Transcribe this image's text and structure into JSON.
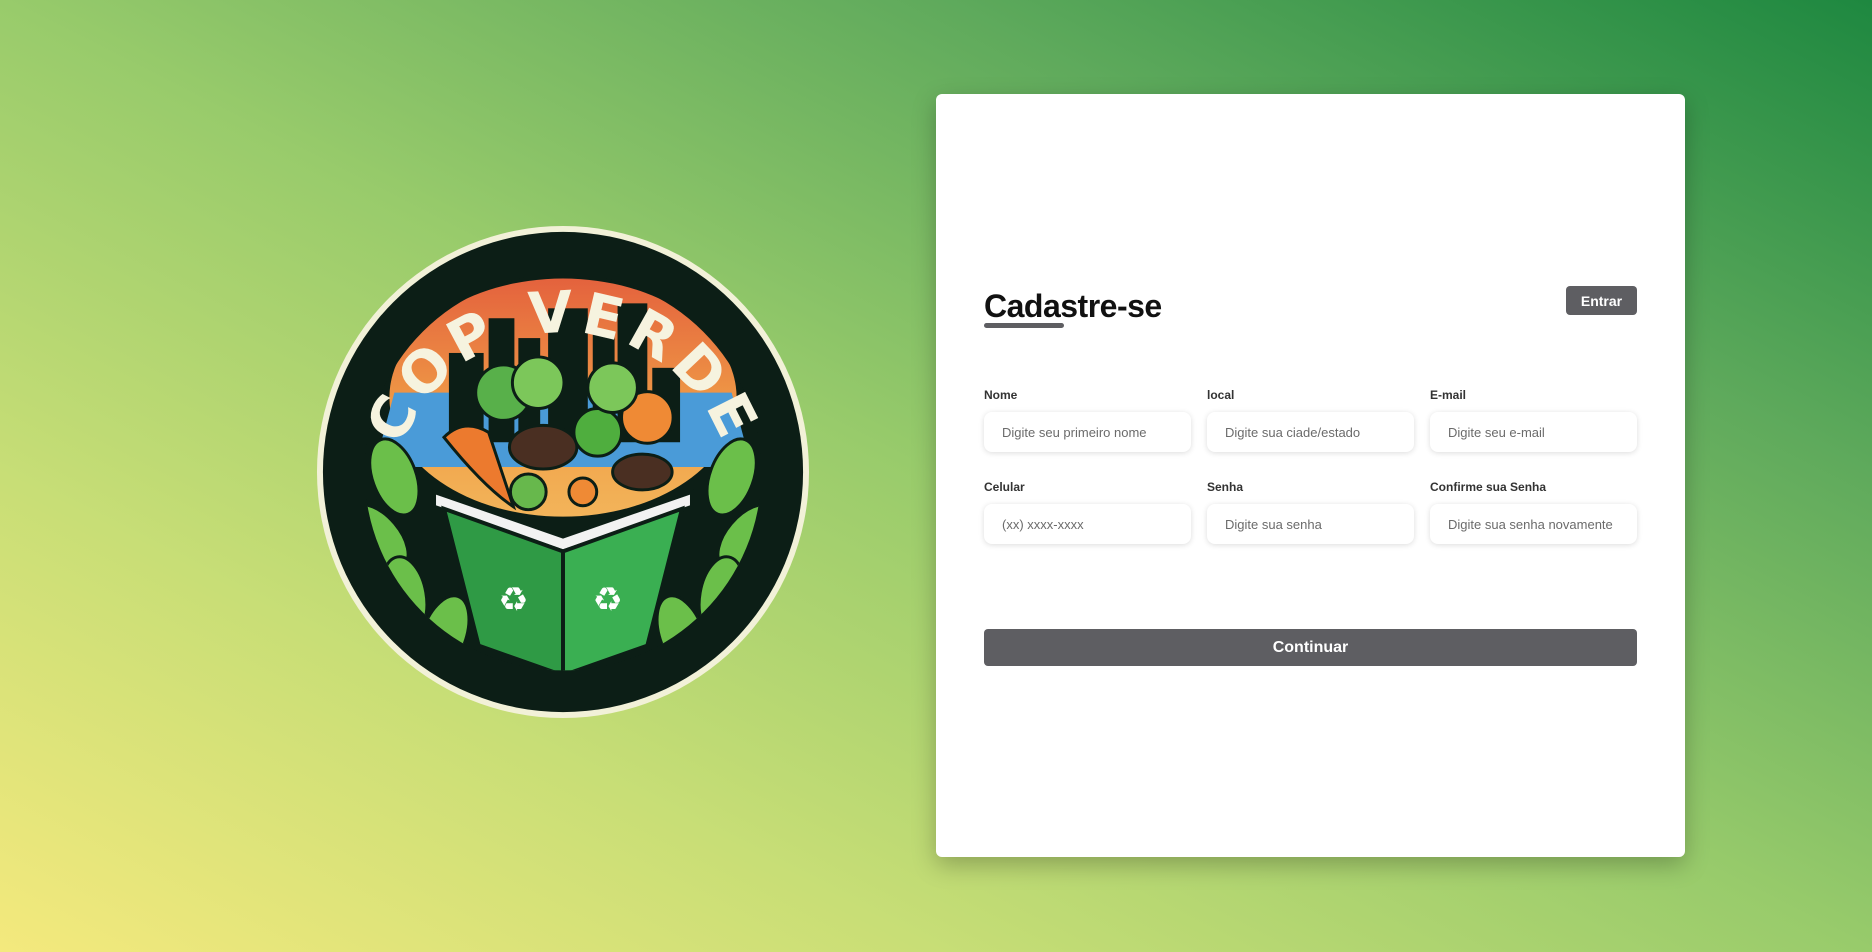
{
  "logo": {
    "brand_text": "COP VERDE",
    "icon": "recycle-bin-with-vegetables-logo"
  },
  "form": {
    "title": "Cadastre-se",
    "enter_button": "Entrar",
    "fields": [
      {
        "label": "Nome",
        "placeholder": "Digite seu primeiro nome",
        "value": ""
      },
      {
        "label": "local",
        "placeholder": "Digite sua ciade/estado",
        "value": ""
      },
      {
        "label": "E-mail",
        "placeholder": "Digite seu e-mail",
        "value": ""
      },
      {
        "label": "Celular",
        "placeholder": "(xx) xxxx-xxxx",
        "value": ""
      },
      {
        "label": "Senha",
        "placeholder": "Digite sua senha",
        "value": ""
      },
      {
        "label": "Confirme sua Senha",
        "placeholder": "Digite sua senha novamente",
        "value": ""
      }
    ],
    "continue_button": "Continuar"
  },
  "colors": {
    "button": "#5e5e62",
    "gradient_top_right": "#1e8840",
    "gradient_bottom_left": "#f4e97d",
    "card": "#ffffff"
  }
}
